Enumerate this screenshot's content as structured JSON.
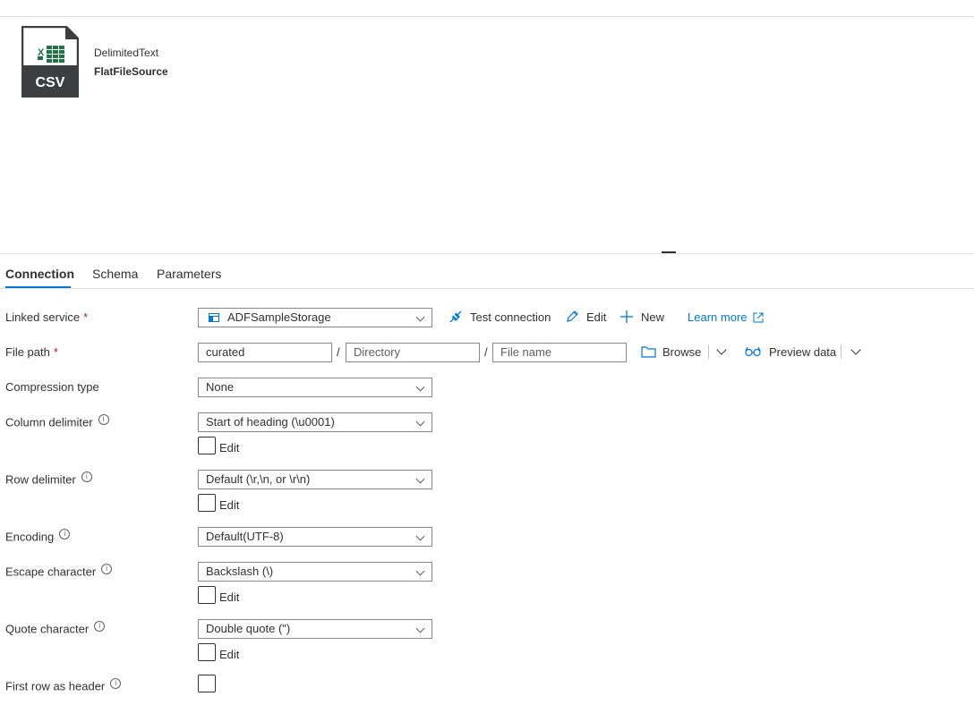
{
  "dataset": {
    "type_label": "DelimitedText",
    "name": "FlatFileSource",
    "icon_text": "CSV"
  },
  "tabs": [
    {
      "label": "Connection",
      "active": true
    },
    {
      "label": "Schema",
      "active": false
    },
    {
      "label": "Parameters",
      "active": false
    }
  ],
  "linked_service": {
    "label": "Linked service",
    "required_mark": "*",
    "value": "ADFSampleStorage",
    "test_connection": "Test connection",
    "edit": "Edit",
    "new": "New",
    "learn_more": "Learn more"
  },
  "file_path": {
    "label": "File path",
    "required_mark": "*",
    "container": "curated",
    "directory_placeholder": "Directory",
    "file_placeholder": "File name",
    "separator": "/",
    "browse": "Browse",
    "preview": "Preview data"
  },
  "compression": {
    "label": "Compression type",
    "value": "None"
  },
  "column_delimiter": {
    "label": "Column delimiter",
    "value": "Start of heading (\\u0001)",
    "edit_label": "Edit"
  },
  "row_delimiter": {
    "label": "Row delimiter",
    "value": "Default (\\r,\\n, or \\r\\n)",
    "edit_label": "Edit"
  },
  "encoding": {
    "label": "Encoding",
    "value": "Default(UTF-8)"
  },
  "escape_character": {
    "label": "Escape character",
    "value": "Backslash (\\)",
    "edit_label": "Edit"
  },
  "quote_character": {
    "label": "Quote character",
    "value": "Double quote (\")",
    "edit_label": "Edit"
  },
  "first_row_header": {
    "label": "First row as header",
    "checked": false
  },
  "colors": {
    "accent": "#0078d4",
    "csv_green": "#217346",
    "icon_dark": "#3b3f42"
  }
}
